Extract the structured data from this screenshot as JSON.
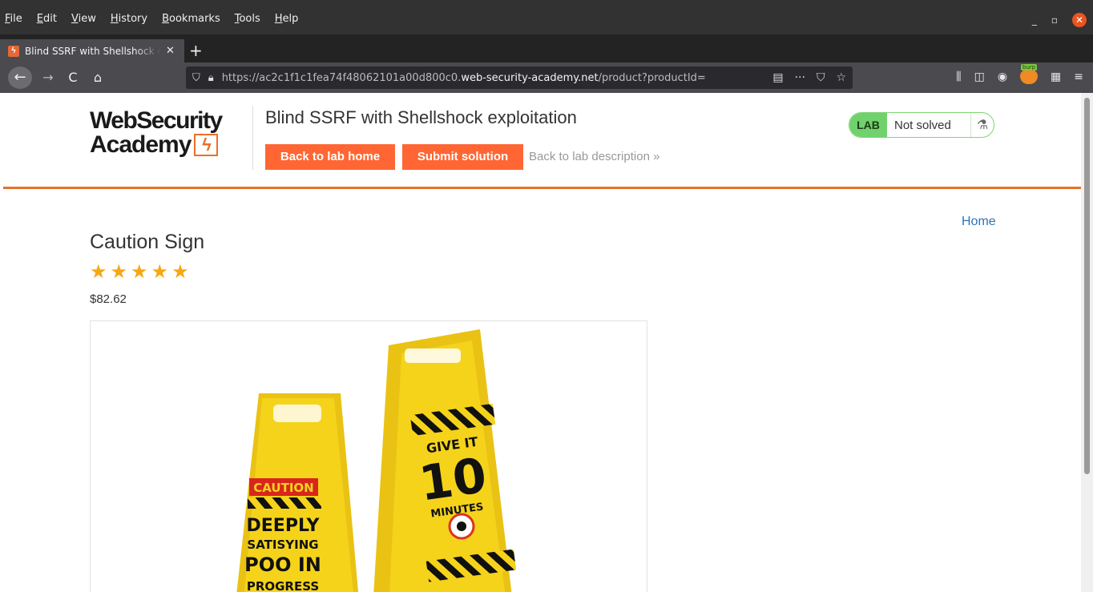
{
  "menubar": {
    "items": [
      "File",
      "Edit",
      "View",
      "History",
      "Bookmarks",
      "Tools",
      "Help"
    ]
  },
  "window_controls": {
    "minimize": "_",
    "restore": "▫",
    "close": "✕"
  },
  "tab": {
    "title": "Blind SSRF with Shellshock exploitation",
    "close": "✕",
    "new_tab": "+"
  },
  "nav": {
    "back": "←",
    "forward": "→",
    "reload": "C",
    "home": "⌂",
    "url_prefix": "https://ac2c1f1c1fea74f48062101a00d800c0.",
    "url_domain": "web-security-academy.net",
    "url_path": "/product?productId=",
    "url_icons": [
      "reader-view-icon",
      "more-icon",
      "pocket-icon",
      "bookmark-star-icon"
    ]
  },
  "lab_header": {
    "logo_line1": "WebSecurity",
    "logo_line2": "Academy",
    "logo_bolt": "ϟ",
    "title": "Blind SSRF with Shellshock exploitation",
    "back_button": "Back to lab home",
    "submit_button": "Submit solution",
    "description_link": "Back to lab description »",
    "status_badge": "LAB",
    "status_text": "Not solved",
    "flask_glyph": "⚗"
  },
  "product": {
    "home_link": "Home",
    "name": "Caution Sign",
    "rating": 5,
    "star_glyph": "★",
    "price": "$82.62",
    "sign_left_top": "CAUTION",
    "sign_left_text": [
      "DEEPLY",
      "SATISYING",
      "POO IN",
      "PROGRESS"
    ],
    "sign_right_text": [
      "GIVE IT",
      "10",
      "MINUTES"
    ]
  },
  "colors": {
    "accent_orange": "#ff6633",
    "header_rule": "#e8702a",
    "lab_green": "#70d16d",
    "link_blue": "#2a72c0",
    "star_gold": "#f7a714",
    "sign_yellow": "#f5d31b"
  }
}
